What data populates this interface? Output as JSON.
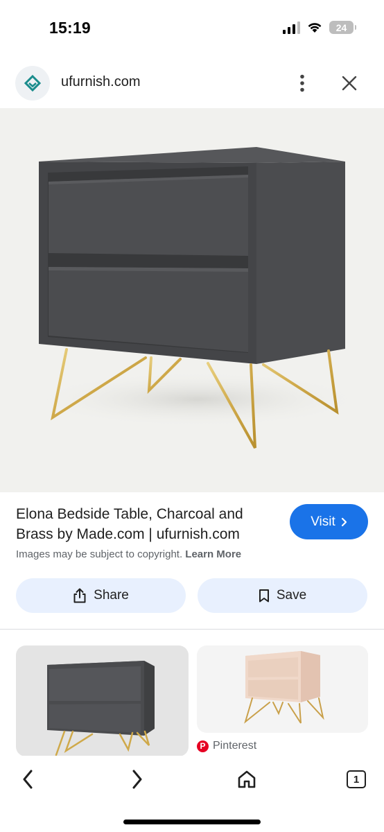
{
  "status_bar": {
    "time": "15:19",
    "battery_level": "24",
    "icons": [
      "signal-icon",
      "wifi-icon",
      "battery-icon"
    ]
  },
  "site_header": {
    "domain": "ufurnish.com",
    "icons": [
      "ufurnish-favicon-icon",
      "more-vert-icon",
      "close-icon"
    ]
  },
  "hero": {
    "subject_icon": "bedside-table-charcoal-two-drawers-brass-legs"
  },
  "result": {
    "title": "Elona Bedside Table, Charcoal and Brass by Made.com | ufurnish.com",
    "visit_label": "Visit",
    "copyright_text": "Images may be subject to copyright.",
    "learn_more_label": "Learn More"
  },
  "actions": {
    "share_label": "Share",
    "save_label": "Save"
  },
  "related": {
    "source_label": "Pinterest"
  },
  "toolbar": {
    "tab_count": "1",
    "icons": [
      "back-icon",
      "forward-icon",
      "home-icon",
      "tabs-icon"
    ]
  },
  "colors": {
    "accent": "#1a73e8",
    "chip_background": "#e8f0fe",
    "table_charcoal": "#4a4b4d",
    "brass": "#d4b25a",
    "pinterest_red": "#e60023"
  }
}
